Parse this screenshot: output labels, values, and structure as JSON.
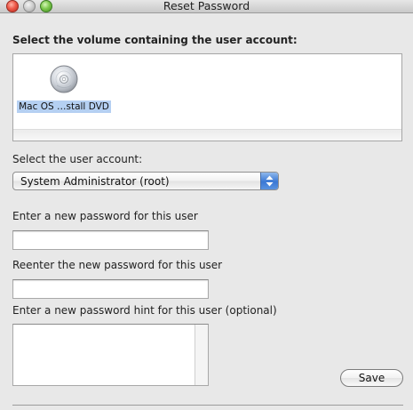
{
  "window": {
    "title": "Reset Password"
  },
  "volume_section": {
    "heading": "Select the volume containing the user account:",
    "volumes": [
      {
        "label": "Mac OS …stall DVD",
        "icon": "dvd-disc-icon",
        "selected": true
      }
    ]
  },
  "account_section": {
    "label": "Select the user account:",
    "selected_value": "System Administrator (root)"
  },
  "password_fields": {
    "new_label": "Enter a new password for this user",
    "new_value": "",
    "reenter_label": "Reenter the new password for this user",
    "reenter_value": "",
    "hint_label": "Enter a new password hint for this user (optional)",
    "hint_value": ""
  },
  "actions": {
    "save_label": "Save"
  },
  "colors": {
    "window_background": "#e8e8e8",
    "selection_highlight": "#b5d0f2",
    "popup_accent": "#3a78d4",
    "close_button": "#ee5a4a",
    "zoom_button": "#7ec84e"
  }
}
